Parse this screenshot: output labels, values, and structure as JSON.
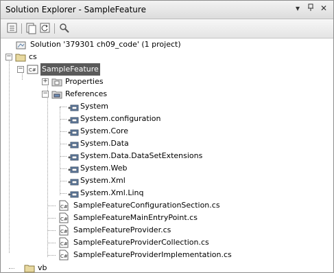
{
  "window": {
    "title": "Solution Explorer - SampleFeature",
    "menu_glyph": "▾",
    "pin_glyph": "ꟷ",
    "close_glyph": "✕"
  },
  "toolbar": {
    "buttons": [
      "properties-icon",
      "show-all-files-icon",
      "refresh-icon",
      "view-class-diagram-icon"
    ]
  },
  "tree": {
    "solution": "Solution '379301 ch09_code' (1 project)",
    "folder_cs": "cs",
    "project": "SampleFeature",
    "properties": "Properties",
    "references": "References",
    "reference_items": [
      "System",
      "System.configuration",
      "System.Core",
      "System.Data",
      "System.Data.DataSetExtensions",
      "System.Web",
      "System.Xml",
      "System.Xml.Linq"
    ],
    "files": [
      "SampleFeatureConfigurationSection.cs",
      "SampleFeatureMainEntryPoint.cs",
      "SampleFeatureProvider.cs",
      "SampleFeatureProviderCollection.cs",
      "SampleFeatureProviderImplementation.cs"
    ],
    "folder_vb": "vb",
    "expander_minus": "−",
    "expander_plus": "+"
  },
  "colors": {
    "selection": "#5a5a5a",
    "folder": "#e8d9a0",
    "reference": "#6e8fb8"
  }
}
